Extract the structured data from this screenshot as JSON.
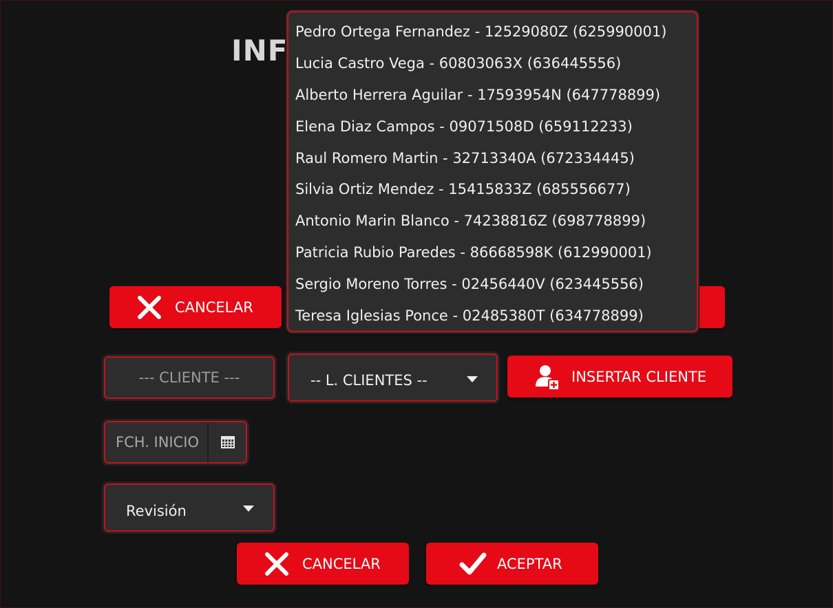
{
  "dialog": {
    "title_partial": "INF"
  },
  "top_buttons": {
    "cancel_label": "CANCELAR"
  },
  "client_section": {
    "client_field_placeholder": "--- CLIENTE ---",
    "client_list_selected": "-- L. CLIENTES --",
    "insert_client_label": "INSERTAR CLIENTE"
  },
  "date_field": {
    "placeholder": "FCH. INICIO"
  },
  "type_select": {
    "selected": "Revisión"
  },
  "bottom_buttons": {
    "cancel_label": "CANCELAR",
    "accept_label": "ACEPTAR"
  },
  "client_dropdown": {
    "items": [
      {
        "label": "Pedro Ortega Fernandez - 12529080Z (625990001)"
      },
      {
        "label": "Lucia Castro Vega - 60803063X (636445556)"
      },
      {
        "label": "Alberto Herrera Aguilar - 17593954N (647778899)"
      },
      {
        "label": "Elena Diaz Campos - 09071508D (659112233)"
      },
      {
        "label": "Raul Romero Martin - 32713340A (672334445)"
      },
      {
        "label": "Silvia Ortiz Mendez - 15415833Z (685556677)"
      },
      {
        "label": "Antonio Marin Blanco - 74238816Z (698778899)"
      },
      {
        "label": "Patricia Rubio Paredes - 86668598K (612990001)"
      },
      {
        "label": "Sergio Moreno Torres - 02456440V (623445556)"
      },
      {
        "label": "Teresa Iglesias Ponce - 02485380T (634778899)"
      }
    ]
  },
  "icons": {
    "cancel": "close-x-icon",
    "accept": "checkmark-icon",
    "insert_client": "add-user-icon",
    "calendar": "calendar-icon",
    "dropdown": "chevron-down-icon"
  },
  "colors": {
    "background": "#151415",
    "accent": "#e50a16",
    "field_bg": "#2e2d2e",
    "field_border": "#c5121b"
  }
}
